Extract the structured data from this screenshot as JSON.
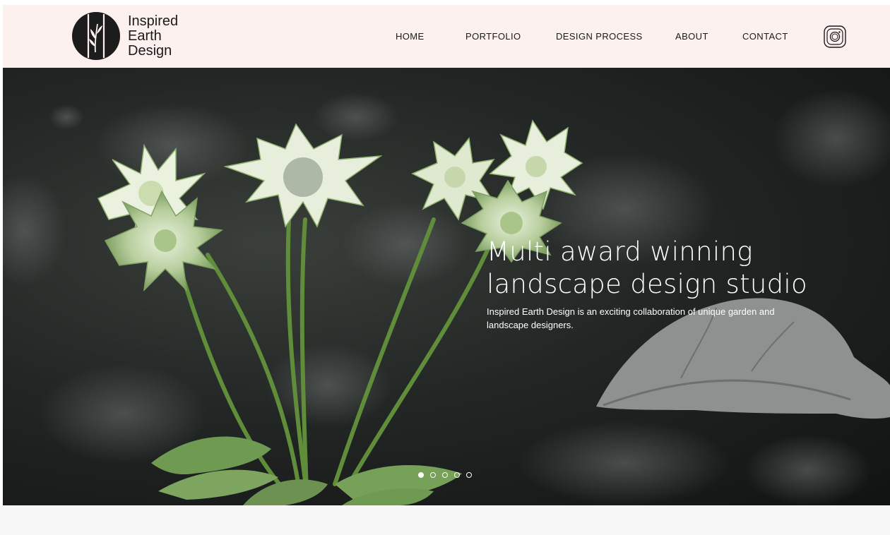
{
  "brand": {
    "name_lines": [
      "Inspired",
      "Earth",
      "Design"
    ],
    "logo_icon": "bamboo-leaf-circle-icon"
  },
  "nav": {
    "items": [
      {
        "label": "HOME"
      },
      {
        "label": "PORTFOLIO"
      },
      {
        "label": "DESIGN PROCESS"
      },
      {
        "label": "ABOUT"
      },
      {
        "label": "CONTACT"
      }
    ],
    "social_icon": "instagram-icon"
  },
  "hero": {
    "title_lines": [
      "Multi award winning",
      "landscape design studio"
    ],
    "subtitle": "Inspired Earth Design is an exciting collaboration of unique garden and landscape designers.",
    "slide_count": 5,
    "active_slide": 1
  },
  "colors": {
    "header_bg": "#fcf1ef",
    "text_dark": "#1a1a1a",
    "hero_text": "#ffffff"
  }
}
